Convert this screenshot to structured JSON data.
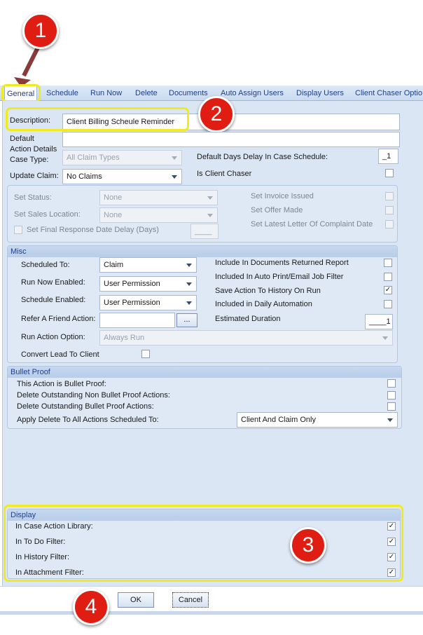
{
  "tabs": [
    "General",
    "Schedule",
    "Run Now",
    "Delete",
    "Documents",
    "Auto Assign Users",
    "Display Users",
    "Client Chaser Optio"
  ],
  "top": {
    "description_label": "Description:",
    "description_value": "Client Billing Scheule Reminder",
    "default_action_details_label_1": "Default",
    "default_action_details_label_2": "Action Details",
    "case_type_label": "Case Type:",
    "case_type_value": "All Claim Types",
    "default_days_delay_label": "Default Days Delay In Case Schedule:",
    "default_days_delay_value": "_1",
    "update_claim_label": "Update Claim:",
    "update_claim_value": "No Claims",
    "is_client_chaser_label": "Is Client Chaser",
    "set_status_label": "Set Status:",
    "set_status_value": "None",
    "set_sales_location_label": "Set Sales Location:",
    "set_sales_location_value": "None",
    "set_final_response_label": "Set Final Response Date Delay (Days)",
    "set_final_response_value": "____",
    "set_invoice_issued_label": "Set Invoice Issued",
    "set_offer_made_label": "Set Offer Made",
    "set_latest_letter_label": "Set Latest Letter Of Complaint Date"
  },
  "misc": {
    "title": "Misc",
    "scheduled_to_label": "Scheduled To:",
    "scheduled_to_value": "Claim",
    "run_now_enabled_label": "Run Now Enabled:",
    "run_now_enabled_value": "User Permission",
    "schedule_enabled_label": "Schedule Enabled:",
    "schedule_enabled_value": "User Permission",
    "refer_friend_label": "Refer A Friend Action:",
    "refer_friend_button": "...",
    "run_action_option_label": "Run Action Option:",
    "run_action_option_value": "Always Run",
    "convert_lead_label": "Convert Lead To Client",
    "include_docs_label": "Include In Documents Returned Report",
    "include_auto_print_label": "Included In Auto Print/Email Job Filter",
    "save_action_history_label": "Save Action To History On Run",
    "save_action_history_check": "✓",
    "included_daily_label": "Included in Daily Automation",
    "estimated_duration_label": "Estimated Duration",
    "estimated_duration_value": "____1"
  },
  "bullet": {
    "title": "Bullet Proof",
    "row1": "This Action is Bullet Proof:",
    "row2": "Delete Outstanding Non Bullet Proof Actions:",
    "row3": "Delete Outstanding Bullet Proof Actions:",
    "row4": "Apply Delete To All Actions Scheduled To:",
    "apply_value": "Client And Claim Only"
  },
  "display": {
    "title": "Display",
    "row1": "In Case Action Library:",
    "row2": "In To Do Filter:",
    "row3": "In History Filter:",
    "row4": "In Attachment Filter:",
    "check": "✓"
  },
  "buttons": {
    "ok": "OK",
    "cancel": "Cancel"
  },
  "callouts": [
    "1",
    "2",
    "3",
    "4"
  ],
  "colors": {
    "callout": "#e01d12",
    "highlight": "#f0ea21",
    "tab_text": "#1e3f8f"
  }
}
